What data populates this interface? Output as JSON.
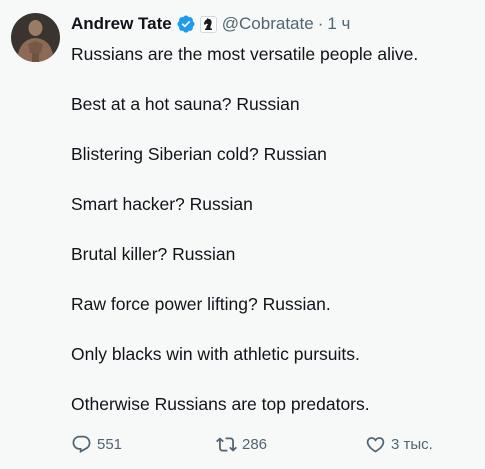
{
  "author": {
    "name": "Andrew Tate",
    "handle": "@Cobratate",
    "separator": "·",
    "time": "1 ч"
  },
  "body_lines": [
    "Russians are the most versatile people alive.",
    "Best at a hot sauna? Russian",
    "Blistering Siberian cold? Russian",
    "Smart hacker? Russian",
    "Brutal killer? Russian",
    "Raw force power lifting? Russian.",
    "Only blacks win with athletic pursuits.",
    "Otherwise Russians are top predators."
  ],
  "actions": {
    "reply_count": "551",
    "retweet_count": "286",
    "like_count": "3 тыс."
  },
  "colors": {
    "background": "#f7f9f9",
    "text": "#0f1419",
    "secondary": "#536471",
    "verified": "#1d9bf0"
  },
  "icons": {
    "verified": "verified-badge-icon",
    "affiliate": "chess-knight-icon",
    "reply": "reply-icon",
    "retweet": "retweet-icon",
    "like": "heart-icon"
  }
}
